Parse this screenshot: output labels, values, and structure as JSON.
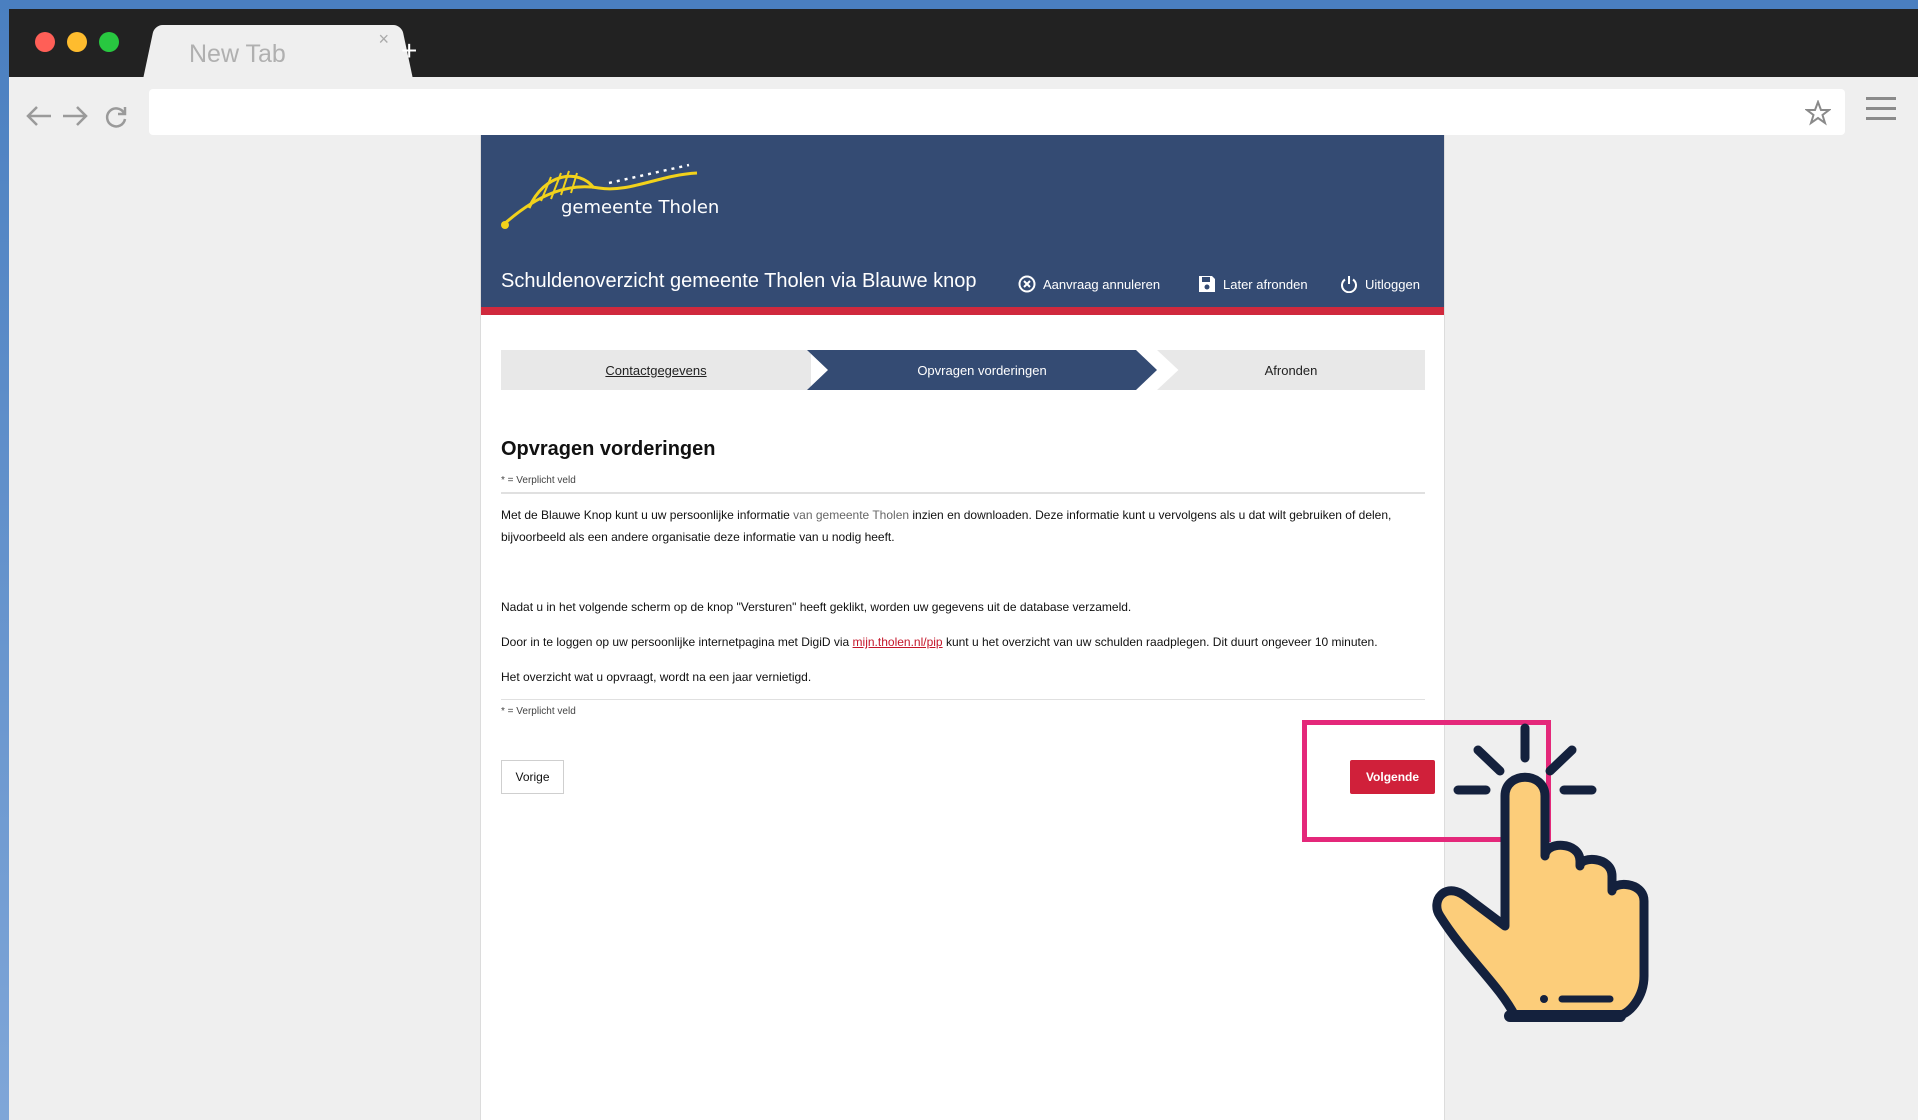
{
  "browser": {
    "tab_title": "New Tab",
    "tab_close": "×",
    "new_tab": "+"
  },
  "header": {
    "logo_text": "gemeente Tholen",
    "title": "Schuldenoverzicht gemeente Tholen via Blauwe knop",
    "actions": {
      "cancel": "Aanvraag annuleren",
      "later": "Later afronden",
      "logout": "Uitloggen"
    }
  },
  "steps": [
    {
      "label": "Contactgegevens"
    },
    {
      "label": "Opvragen vorderingen"
    },
    {
      "label": "Afronden"
    }
  ],
  "content": {
    "heading": "Opvragen vorderingen",
    "required_note": "* = Verplicht veld",
    "para1_a": "Met de Blauwe Knop kunt u uw persoonlijke informatie ",
    "para1_muted": "van gemeente Tholen",
    "para1_b": " inzien en downloaden. Deze informatie kunt u vervolgens als u dat wilt gebruiken of delen, bijvoorbeeld als een andere organisatie deze informatie van u nodig heeft.",
    "para2": "Nadat u in het volgende scherm op de knop \"Versturen\" heeft geklikt, worden uw gegevens uit de database verzameld.",
    "para3_a": "Door in te loggen op uw persoonlijke internetpagina met DigiD via ",
    "para3_link": "mijn.tholen.nl/pip",
    "para3_b": " kunt u het overzicht van uw schulden raadplegen. Dit duurt ongeveer 10 minuten.",
    "para4": "Het overzicht wat u opvraagt, wordt na een jaar vernietigd.",
    "required_note_bottom": "* = Verplicht veld"
  },
  "buttons": {
    "previous": "Vorige",
    "next": "Volgende"
  },
  "colors": {
    "header_bg": "#344b73",
    "accent_red": "#d0203a",
    "highlight": "#e4287a",
    "logo_yellow": "#f2d21b"
  }
}
